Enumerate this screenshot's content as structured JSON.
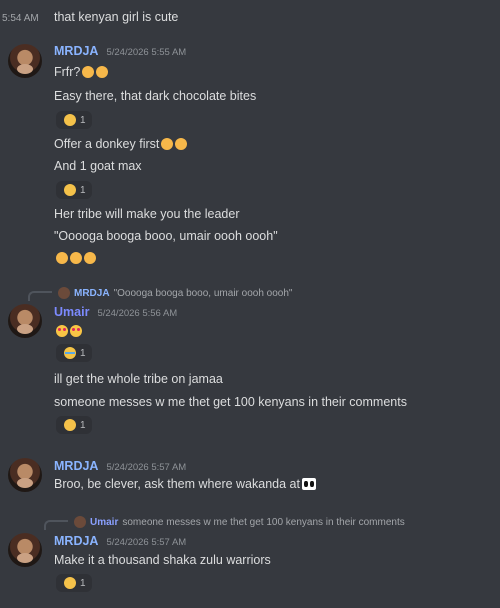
{
  "colors": {
    "mrdja": "#8ab4ff",
    "umair": "#7c8aff",
    "background": "#36393f",
    "text": "#dcddde",
    "muted": "#8e9297"
  },
  "top_message": {
    "timestamp": "5:54 AM",
    "text": "that kenyan girl is cute"
  },
  "group1": {
    "author": "MRDJA",
    "timestamp": "5/24/2026 5:55 AM",
    "lines": [
      "Frfr?",
      "Easy there, that dark chocolate bites",
      "Offer a donkey first",
      "And 1 goat max",
      "Her tribe will make you the leader",
      "\"Ooooga booga booo, umair oooh oooh\""
    ],
    "reactions": [
      {
        "emoji": "joy-icon",
        "count": "1"
      },
      {
        "emoji": "joy-icon",
        "count": "1"
      }
    ]
  },
  "group2": {
    "reply": {
      "author": "MRDJA",
      "text": "\"Ooooga booga booo, umair oooh oooh\""
    },
    "author": "Umair",
    "timestamp": "5/24/2026 5:56 AM",
    "lines": [
      "ill get the whole tribe on jamaa",
      "someone messes w me thet get 100 kenyans in their comments"
    ],
    "reactions": [
      {
        "emoji": "sob-icon",
        "count": "1"
      },
      {
        "emoji": "joy-icon",
        "count": "1"
      }
    ]
  },
  "group3": {
    "author": "MRDJA",
    "timestamp": "5/24/2026 5:57 AM",
    "lines": [
      "Broo, be clever, ask them where wakanda at"
    ]
  },
  "group4": {
    "reply": {
      "author": "Umair",
      "text": "someone messes w me thet get 100 kenyans in their comments"
    },
    "author": "MRDJA",
    "timestamp": "5/24/2026 5:57 AM",
    "lines": [
      "Make it a thousand shaka zulu warriors"
    ],
    "reactions": [
      {
        "emoji": "joy-icon",
        "count": "1"
      }
    ]
  }
}
